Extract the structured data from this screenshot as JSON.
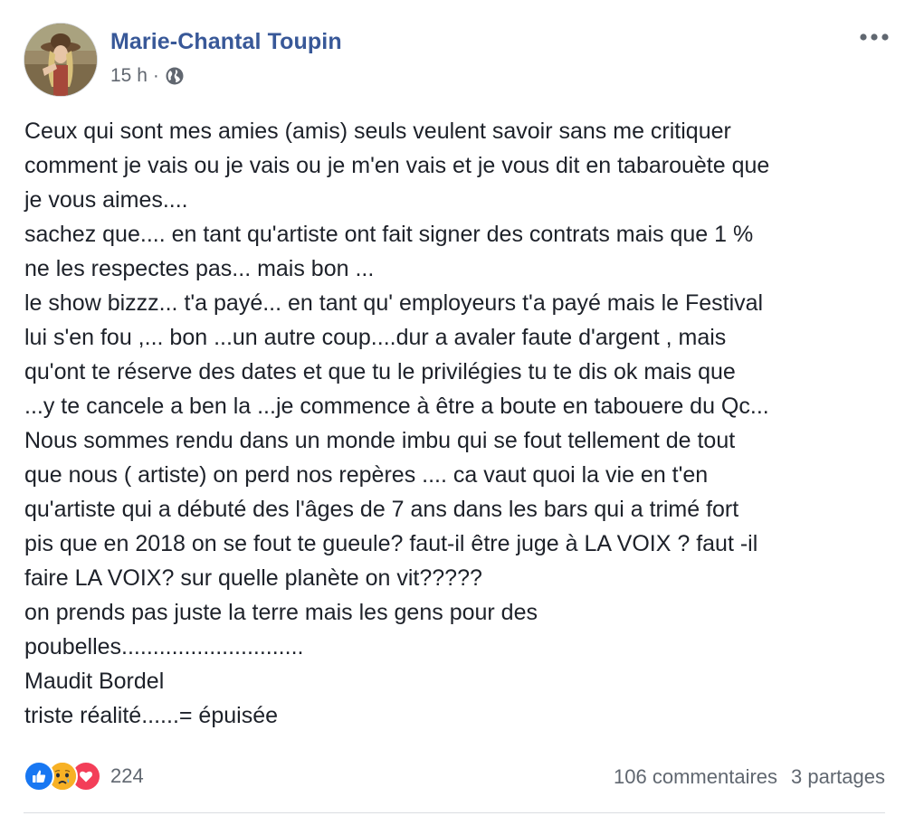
{
  "post": {
    "author": "Marie-Chantal Toupin",
    "time": "15 h",
    "separator": "·",
    "privacy_icon": "globe-icon",
    "more_icon": "more-options-icon",
    "lines": [
      "Ceux qui sont mes amies (amis) seuls veulent savoir sans me critiquer",
      "comment je vais ou je vais ou je m'en vais et je vous dit en tabarouète que",
      "je vous aimes....",
      "sachez que.... en tant qu'artiste ont fait signer des contrats mais que 1 %",
      "ne les respectes pas... mais bon ...",
      "le show bizzz... t'a payé... en tant qu' employeurs t'a payé mais le Festival",
      "lui s'en fou ,... bon ...un autre coup....dur a avaler faute d'argent , mais",
      "qu'ont te réserve des dates et que tu le privilégies tu te dis ok mais que",
      "...y te cancele a ben la ...je commence à être a boute en tabouere du Qc...",
      "Nous sommes rendu dans un monde imbu qui se fout tellement de tout",
      "que nous ( artiste) on perd nos repères .... ca vaut quoi la vie en t'en",
      "qu'artiste qui a débuté des l'âges de 7 ans dans les bars qui a trimé fort",
      "pis que en 2018 on se fout te gueule? faut-il être juge à LA VOIX ? faut -il",
      "faire LA VOIX? sur quelle planète on vit?????",
      "on prends pas juste la terre mais les gens pour des",
      "poubelles.............................",
      "Maudit Bordel",
      "triste réalité......= épuisée"
    ]
  },
  "footer": {
    "reaction_icons": [
      "like-icon",
      "sad-icon",
      "love-icon"
    ],
    "reaction_count": "224",
    "comments": "106 commentaires",
    "shares": "3 partages"
  },
  "colors": {
    "author": "#385898",
    "meta": "#616770",
    "like": "#1877f2",
    "sad": "#f7b125",
    "love": "#f33e58"
  }
}
